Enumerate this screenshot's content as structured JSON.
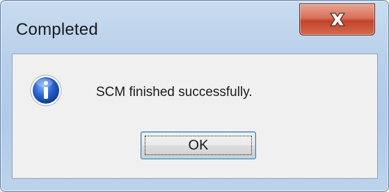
{
  "window": {
    "title": "Completed",
    "close_icon": "close-icon"
  },
  "dialog": {
    "icon": "info-icon",
    "message": "SCM finished successfully.",
    "ok_label": "OK"
  },
  "colors": {
    "close_button": "#c9452b",
    "icon_blue": "#1f4fb5",
    "button_focus_border": "#3c7fb1"
  }
}
